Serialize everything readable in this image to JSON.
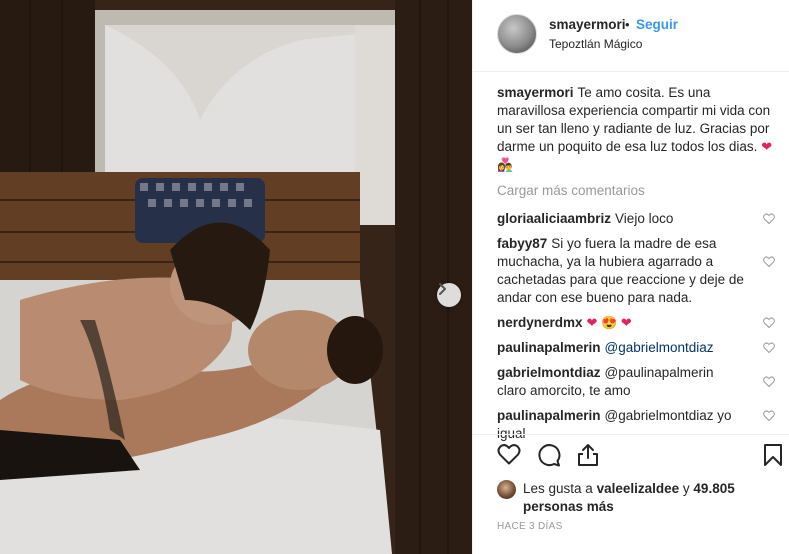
{
  "header": {
    "username": "smayermori",
    "separator": "•",
    "follow_label": "Seguir",
    "location": "Tepoztlán Mágico"
  },
  "caption": {
    "username": "smayermori",
    "text": "Te amo cosita. Es una maravillosa experiencia compartir mi vida con un ser tan lleno y radiante de luz. Gracias por darme un poquito de esa luz todos los dias.",
    "emoji": "❤ 👩‍❤️‍👨"
  },
  "load_more_label": "Cargar más comentarios",
  "comments": [
    {
      "username": "gloriaaliciaambriz",
      "text": "Viejo loco"
    },
    {
      "username": "fabyy87",
      "text": "Si yo fuera la madre de esa muchacha, ya la hubiera agarrado a cachetadas para que reaccione y deje de andar con ese bueno para nada."
    },
    {
      "username": "nerdynerdmx",
      "text": "❤ 😍 ❤"
    },
    {
      "username": "paulinapalmerin",
      "text": "@gabrielmontdiaz"
    },
    {
      "username": "gabrielmontdiaz",
      "text": "@paulinapalmerin claro amorcito, te amo"
    },
    {
      "username": "paulinapalmerin",
      "text": "@gabrielmontdiaz yo igual"
    }
  ],
  "likes": {
    "prefix": "Les gusta a",
    "liker": "valeelizaldee",
    "conj": "y",
    "count": "49.805 personas más"
  },
  "timestamp": "HACE 3 DÍAS",
  "icons": {
    "like": "heart-icon",
    "comment": "comment-icon",
    "share": "share-icon",
    "save": "bookmark-icon",
    "next": "chevron-right-icon"
  },
  "colors": {
    "link": "#3897f0",
    "muted": "#999999",
    "text": "#262626",
    "border": "#efefef"
  }
}
